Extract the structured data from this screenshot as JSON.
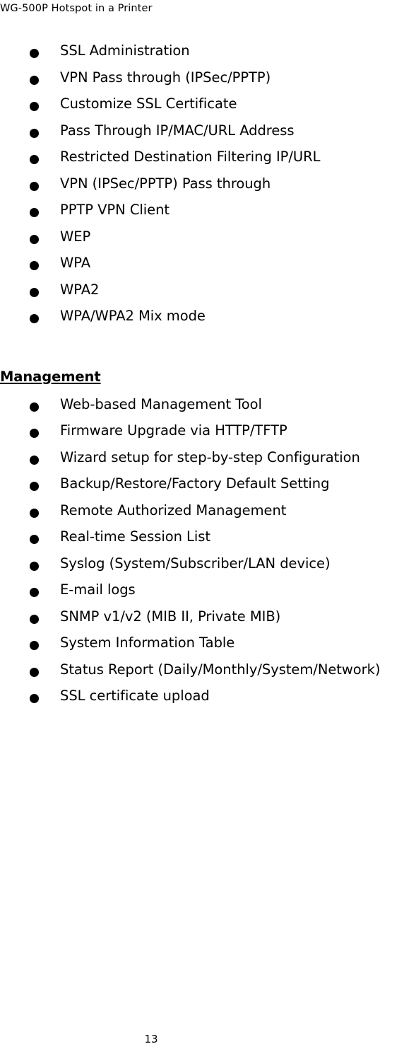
{
  "document": {
    "running_header": "WG-500P Hotspot in a Printer",
    "page_number": "13",
    "bullet_glyph": "filled-round-bullet",
    "text_color": "#000000",
    "background_color": "#ffffff"
  },
  "sections": [
    {
      "heading": "",
      "items": [
        "SSL Administration",
        "VPN Pass through (IPSec/PPTP)",
        "Customize SSL Certificate",
        "Pass Through IP/MAC/URL Address",
        "Restricted Destination Filtering IP/URL",
        "VPN (IPSec/PPTP) Pass through",
        "PPTP VPN Client",
        "WEP",
        "WPA",
        "WPA2",
        "WPA/WPA2 Mix mode"
      ]
    },
    {
      "heading": "Management",
      "items": [
        "Web-based Management Tool",
        "Firmware Upgrade via HTTP/TFTP",
        "Wizard setup for step-by-step Configuration",
        "Backup/Restore/Factory Default Setting",
        "Remote Authorized Management",
        "Real-time Session List",
        "Syslog (System/Subscriber/LAN device)",
        "E-mail logs",
        "SNMP v1/v2 (MIB II, Private MIB)",
        "System Information Table",
        "Status Report (Daily/Monthly/System/Network)",
        "SSL certificate upload"
      ]
    }
  ]
}
